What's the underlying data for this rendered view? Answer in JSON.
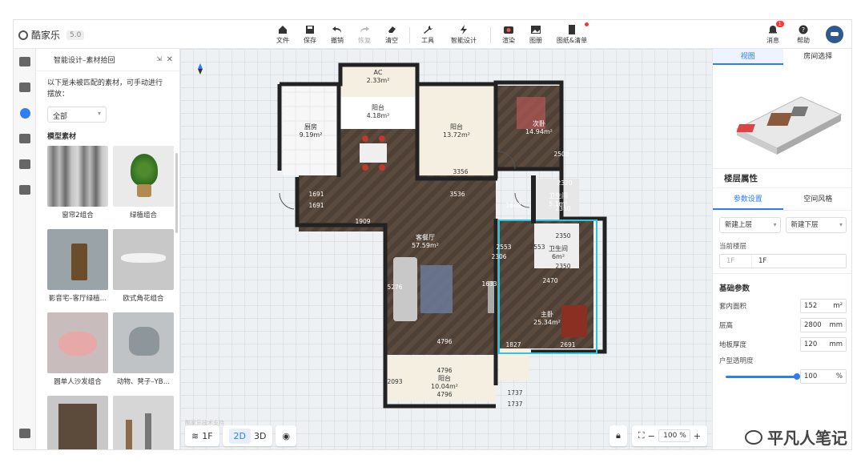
{
  "app": {
    "logo": "酷家乐",
    "version": "5.0"
  },
  "toolbar": {
    "items": [
      {
        "label": "文件",
        "icon": "house-icon"
      },
      {
        "label": "保存",
        "icon": "save-icon"
      },
      {
        "label": "撤销",
        "icon": "undo-icon"
      },
      {
        "label": "恢复",
        "icon": "redo-icon"
      },
      {
        "label": "清空",
        "icon": "eraser-icon"
      },
      {
        "label": "工具",
        "icon": "wrench-icon"
      },
      {
        "label": "智能设计",
        "icon": "lightning-icon"
      },
      {
        "label": "渲染",
        "icon": "camera-icon"
      },
      {
        "label": "图册",
        "icon": "album-icon"
      },
      {
        "label": "图纸&清单",
        "icon": "document-icon"
      }
    ]
  },
  "topright": {
    "messages": "消息",
    "message_count": "1",
    "help": "帮助"
  },
  "left_panel": {
    "title": "智能设计–素材拾回",
    "desc": "以下是未被匹配的素材，可手动进行摆放：",
    "filter": "全部",
    "section": "模型素材",
    "items": [
      {
        "label": "窗帘2组合"
      },
      {
        "label": "绿植组合"
      },
      {
        "label": "影音宅–客厅绿植…"
      },
      {
        "label": "欧式角花组合"
      },
      {
        "label": "圆单人沙发组合"
      },
      {
        "label": "动物、凳子–YB…"
      },
      {
        "label": ""
      },
      {
        "label": ""
      }
    ]
  },
  "canvas": {
    "watermark": "酷家乐技术支持",
    "floor_btn": "1F",
    "view2d": "2D",
    "view3d": "3D",
    "zoom": "100",
    "zoom_unit": "%",
    "rooms": [
      {
        "name": "AC",
        "area": "2.33m²"
      },
      {
        "name": "阳台",
        "area": "4.18m²"
      },
      {
        "name": "厨房",
        "area": "9.19m²"
      },
      {
        "name": "阳台",
        "area": "13.72m²"
      },
      {
        "name": "次卧",
        "area": "14.94m²"
      },
      {
        "name": "卫生间",
        "area": "5.1m²"
      },
      {
        "name": "客餐厅",
        "area": "57.59m²"
      },
      {
        "name": "卫生间",
        "area": "6m²"
      },
      {
        "name": "主卧",
        "area": "25.34m²"
      },
      {
        "name": "阳台",
        "area": "10.04m²"
      }
    ],
    "dims": [
      "2500",
      "3356",
      "3536",
      "1909",
      "2320",
      "2350",
      "2350",
      "2350",
      "2553",
      "2553",
      "2470",
      "1827",
      "2691",
      "4796",
      "4796",
      "4796",
      "2093",
      "1737",
      "1737",
      "1691",
      "1691",
      "2306",
      "5276",
      "1649",
      "1633"
    ]
  },
  "right_panel": {
    "tabs": [
      "视图",
      "房间选择"
    ],
    "prop_title": "楼层属性",
    "ptabs": [
      "参数设置",
      "空间风格"
    ],
    "new_up": "新建上层",
    "new_down": "新建下层",
    "current_floor_label": "当前楼层",
    "floor_a": "1F",
    "floor_b": "1F",
    "basic": "基础参数",
    "rows": [
      {
        "k": "套内面积",
        "v": "152",
        "u": "m²"
      },
      {
        "k": "层高",
        "v": "2800",
        "u": "mm"
      },
      {
        "k": "地板厚度",
        "v": "120",
        "u": "mm"
      }
    ],
    "transparency_label": "户型透明度",
    "transparency": "100",
    "transparency_unit": "%"
  },
  "watermark_text": "平凡人笔记"
}
